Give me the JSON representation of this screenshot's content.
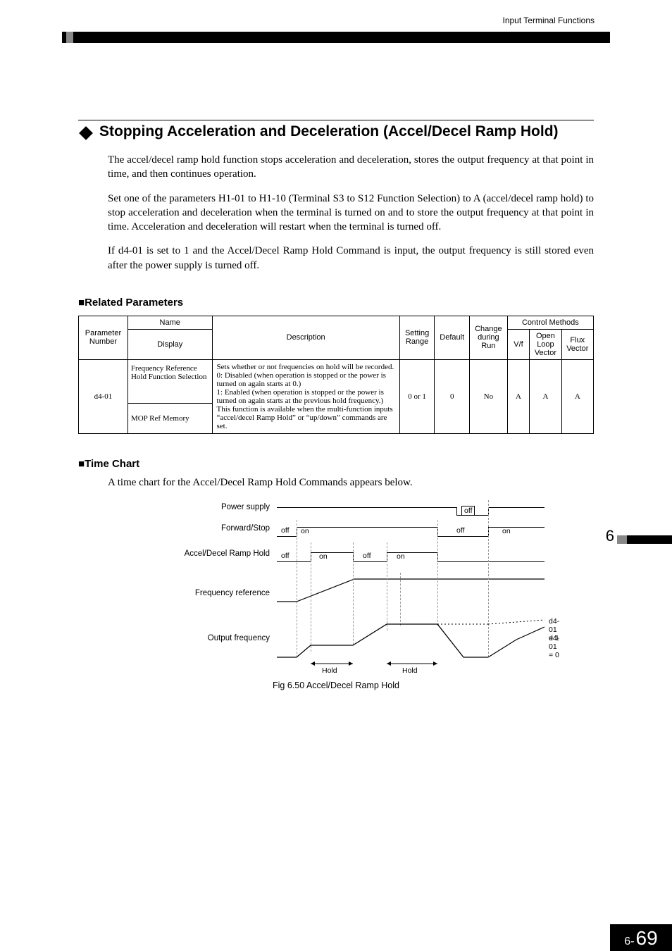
{
  "header": {
    "section_label": "Input Terminal Functions"
  },
  "section": {
    "title": "Stopping Acceleration and Deceleration (Accel/Decel Ramp Hold)",
    "paras": [
      "The accel/decel ramp hold function stops acceleration and deceleration, stores the output frequency at that point in time, and then continues operation.",
      "Set one of the parameters H1-01 to H1-10 (Terminal S3 to S12 Function Selection) to A (accel/decel ramp hold) to stop acceleration and deceleration when the terminal is turned on and to store the output frequency at that point in time. Acceleration and deceleration will restart when the terminal is turned off.",
      "If d4-01 is set to 1 and the Accel/Decel Ramp Hold Command is input, the output frequency is still stored even after the power supply is turned off."
    ]
  },
  "related": {
    "heading": "Related Parameters",
    "headers": {
      "param_no": "Parameter Number",
      "name": "Name",
      "display": "Display",
      "description": "Description",
      "setting_range": "Setting Range",
      "default": "Default",
      "change_run": "Change during Run",
      "control_methods": "Control Methods",
      "vf": "V/f",
      "olv": "Open Loop Vector",
      "flux": "Flux Vector"
    },
    "row": {
      "param_no": "d4-01",
      "name": "Frequency Reference Hold Function Selection",
      "display": "MOP Ref Memory",
      "description": "Sets whether or not frequencies on hold will be recorded.\n0:  Disabled (when operation is stopped or the power is turned on again starts at 0.)\n1:  Enabled (when operation is stopped or the power is turned on again starts at the previous hold frequency.)\nThis function is available when the multi-function inputs “accel/decel Ramp Hold” or “up/down” commands are set.",
      "setting_range": "0 or 1",
      "default": "0",
      "change_run": "No",
      "vf": "A",
      "olv": "A",
      "flux": "A"
    }
  },
  "timechart": {
    "heading": "Time Chart",
    "intro": "A time chart for the Accel/Decel Ramp Hold Commands appears below.",
    "rows": {
      "power": "Power supply",
      "fwd": "Forward/Stop",
      "ramp": "Accel/Decel Ramp Hold",
      "freqref": "Frequency reference",
      "out": "Output frequency"
    },
    "labels": {
      "off": "off",
      "on": "on",
      "hold": "Hold",
      "d401_1": "d4-01 = 1",
      "d401_0": "d4-01 = 0"
    },
    "caption": "Fig 6.50   Accel/Decel Ramp Hold"
  },
  "side": {
    "chapter": "6"
  },
  "page": {
    "prefix": "6-",
    "number": "69"
  },
  "chart_data": {
    "type": "timing-diagram",
    "time_axis_units": "arbitrary",
    "signals": [
      {
        "name": "Power supply",
        "segments": [
          {
            "t0": 0,
            "t1": 250,
            "level": "on"
          },
          {
            "t0": 250,
            "t1": 300,
            "level": "off"
          },
          {
            "t0": 300,
            "t1": 380,
            "level": "on"
          }
        ]
      },
      {
        "name": "Forward/Stop",
        "segments": [
          {
            "t0": 0,
            "t1": 25,
            "level": "off"
          },
          {
            "t0": 25,
            "t1": 230,
            "level": "on"
          },
          {
            "t0": 230,
            "t1": 300,
            "level": "off"
          },
          {
            "t0": 300,
            "t1": 380,
            "level": "on"
          }
        ]
      },
      {
        "name": "Accel/Decel Ramp Hold",
        "segments": [
          {
            "t0": 0,
            "t1": 45,
            "level": "off"
          },
          {
            "t0": 45,
            "t1": 105,
            "level": "on"
          },
          {
            "t0": 105,
            "t1": 155,
            "level": "off"
          },
          {
            "t0": 155,
            "t1": 230,
            "level": "on"
          },
          {
            "t0": 230,
            "t1": 380,
            "level": "off"
          }
        ]
      },
      {
        "name": "Frequency reference",
        "type": "analog",
        "points": [
          {
            "t": 0,
            "v": 0
          },
          {
            "t": 25,
            "v": 0
          },
          {
            "t": 110,
            "v": 1
          },
          {
            "t": 380,
            "v": 1
          }
        ]
      },
      {
        "name": "Output frequency",
        "type": "analog",
        "note": "Ramps up, holds during Ramp Hold on, resumes, decel at stop; after power cycle starts at 0 if d4-01=0 or at stored value if d4-01=1",
        "points_d4_01_0": [
          {
            "t": 0,
            "v": 0
          },
          {
            "t": 25,
            "v": 0
          },
          {
            "t": 45,
            "v": 0.25
          },
          {
            "t": 105,
            "v": 0.25
          },
          {
            "t": 155,
            "v": 0.8
          },
          {
            "t": 230,
            "v": 0.8
          },
          {
            "t": 265,
            "v": 0
          },
          {
            "t": 300,
            "v": 0
          },
          {
            "t": 340,
            "v": 0.5
          },
          {
            "t": 380,
            "v": 0.9
          }
        ],
        "points_d4_01_1": [
          {
            "t": 300,
            "v": 0.8
          },
          {
            "t": 380,
            "v": 0.95
          }
        ]
      }
    ],
    "annotations": [
      "Hold",
      "Hold",
      "d4-01 = 1",
      "d4-01 = 0"
    ]
  }
}
